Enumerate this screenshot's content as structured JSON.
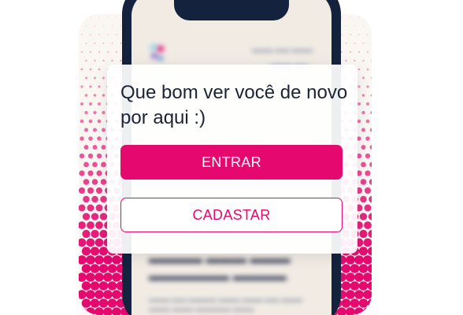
{
  "backdrop": {
    "dot_color": "#e5086e",
    "background_color": "#faf7f3"
  },
  "phone": {
    "frame_color": "#14223e",
    "screen_color": "#f1ebe4",
    "logo_icon": "colorful-dots-logo-icon"
  },
  "card": {
    "title": "Que bom ver você de novo por aqui :)",
    "login_label": "ENTRAR",
    "signup_label": "CADASTAR"
  },
  "colors": {
    "accent": "#e5086e",
    "text": "#1b2336"
  }
}
